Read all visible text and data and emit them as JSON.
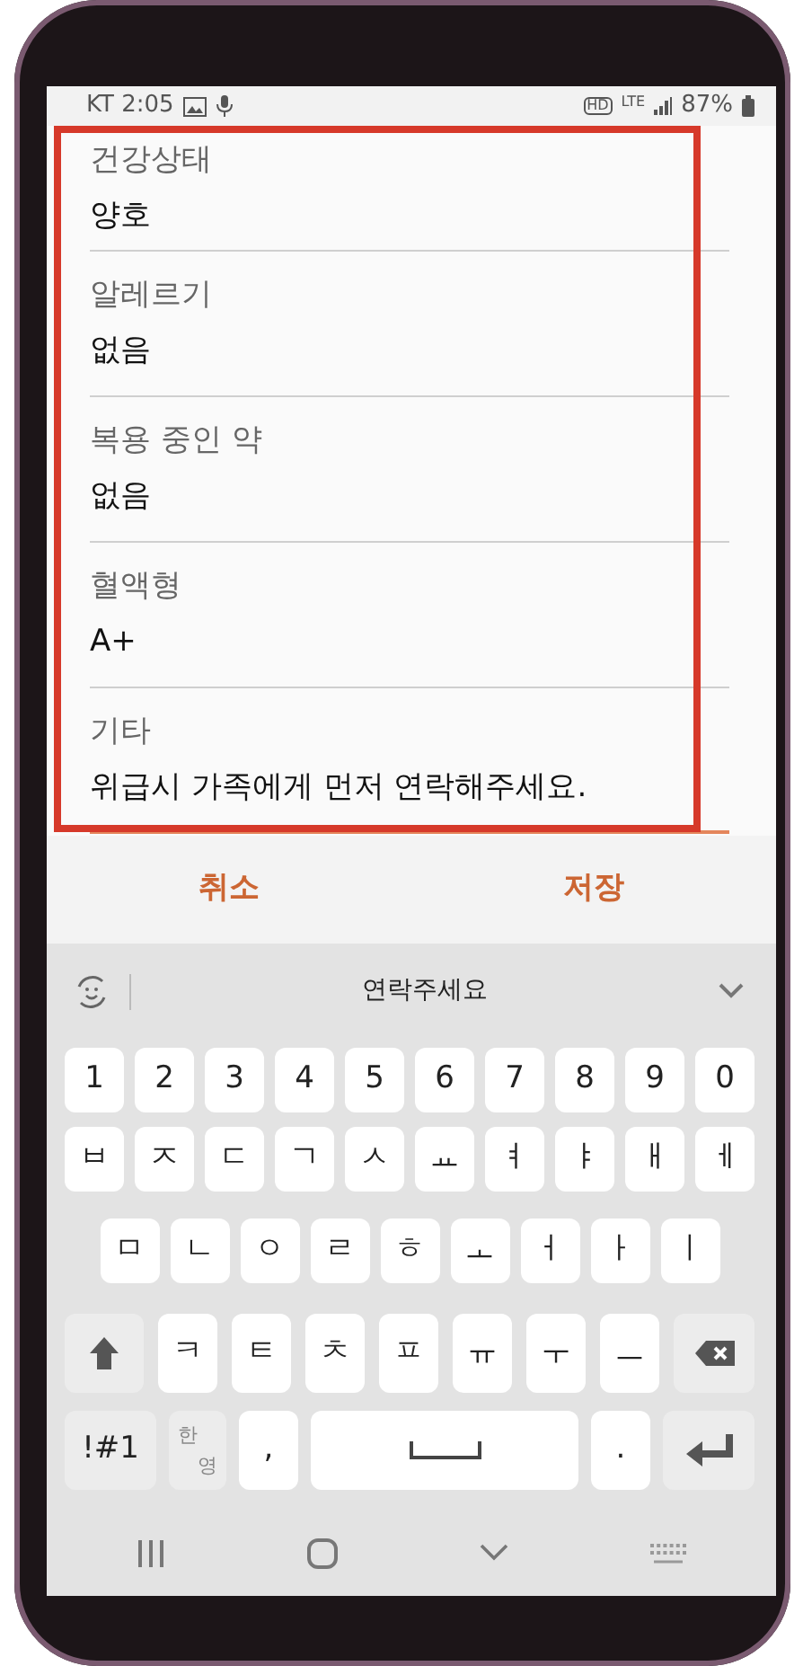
{
  "status_bar": {
    "carrier_time": "KT 2:05",
    "network": "LTE",
    "hd": "HD",
    "battery": "87%"
  },
  "fields": [
    {
      "label": "건강상태",
      "value": "양호",
      "focused": false
    },
    {
      "label": "알레르기",
      "value": "없음",
      "focused": false
    },
    {
      "label": "복용 중인 약",
      "value": "없음",
      "focused": false
    },
    {
      "label": "혈액형",
      "value": "A+",
      "focused": false
    },
    {
      "label": "기타",
      "value": "위급시 가족에게 먼저 연락해주세요.",
      "focused": true
    }
  ],
  "dialog_buttons": [
    {
      "label": "취소"
    },
    {
      "label": "저장"
    }
  ],
  "suggestion": "연락주세요",
  "keyboard": [
    [
      {
        "kind": "char",
        "label": "1"
      },
      {
        "kind": "char",
        "label": "2"
      },
      {
        "kind": "char",
        "label": "3"
      },
      {
        "kind": "char",
        "label": "4"
      },
      {
        "kind": "char",
        "label": "5"
      },
      {
        "kind": "char",
        "label": "6"
      },
      {
        "kind": "char",
        "label": "7"
      },
      {
        "kind": "char",
        "label": "8"
      },
      {
        "kind": "char",
        "label": "9"
      },
      {
        "kind": "char",
        "label": "0"
      }
    ],
    [
      {
        "kind": "char",
        "label": "ㅂ"
      },
      {
        "kind": "char",
        "label": "ㅈ"
      },
      {
        "kind": "char",
        "label": "ㄷ"
      },
      {
        "kind": "char",
        "label": "ㄱ"
      },
      {
        "kind": "char",
        "label": "ㅅ"
      },
      {
        "kind": "char",
        "label": "ㅛ"
      },
      {
        "kind": "char",
        "label": "ㅕ"
      },
      {
        "kind": "char",
        "label": "ㅑ"
      },
      {
        "kind": "char",
        "label": "ㅐ"
      },
      {
        "kind": "char",
        "label": "ㅔ"
      }
    ],
    [
      {
        "kind": "char",
        "label": "ㅁ"
      },
      {
        "kind": "char",
        "label": "ㄴ"
      },
      {
        "kind": "char",
        "label": "ㅇ"
      },
      {
        "kind": "char",
        "label": "ㄹ"
      },
      {
        "kind": "char",
        "label": "ㅎ"
      },
      {
        "kind": "char",
        "label": "ㅗ"
      },
      {
        "kind": "char",
        "label": "ㅓ"
      },
      {
        "kind": "char",
        "label": "ㅏ"
      },
      {
        "kind": "char",
        "label": "ㅣ"
      }
    ],
    [
      {
        "kind": "shift"
      },
      {
        "kind": "char",
        "label": "ㅋ"
      },
      {
        "kind": "char",
        "label": "ㅌ"
      },
      {
        "kind": "char",
        "label": "ㅊ"
      },
      {
        "kind": "char",
        "label": "ㅍ"
      },
      {
        "kind": "char",
        "label": "ㅠ"
      },
      {
        "kind": "char",
        "label": "ㅜ"
      },
      {
        "kind": "char",
        "label": "ㅡ"
      },
      {
        "kind": "backspace"
      }
    ],
    [
      {
        "kind": "symbols",
        "label": "!#1"
      },
      {
        "kind": "lang",
        "top": "한",
        "bottom": "영"
      },
      {
        "kind": "char",
        "label": ","
      },
      {
        "kind": "space"
      },
      {
        "kind": "char",
        "label": "."
      },
      {
        "kind": "enter"
      }
    ]
  ]
}
